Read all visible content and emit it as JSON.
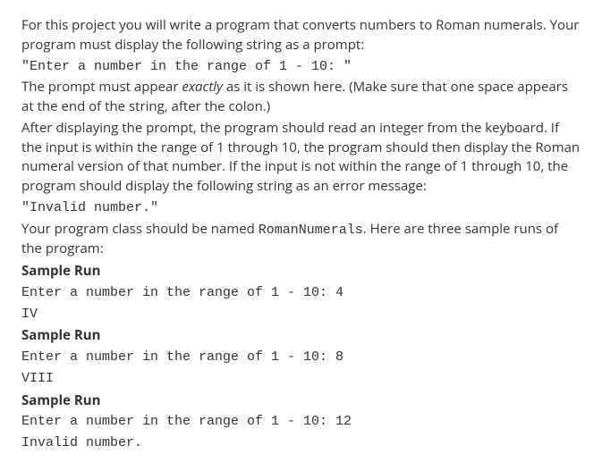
{
  "intro": {
    "p1": "For this project you will write a program that converts numbers to Roman numerals. Your program must display the following string as a prompt:",
    "prompt_code": "\"Enter a number in the range of 1 - 10: \"",
    "p2_a": "The prompt must appear ",
    "p2_exactly": "exactly",
    "p2_b": " as it is shown here. (Make sure that one space appears at the end of the string, after the colon.)",
    "p3": "After displaying the prompt, the program should read an integer from the keyboard. If the input is within the range of 1 through 10, the program should then display the Roman numeral version of that number. If the input is not within the range of 1 through 10, the program should display the following string as an error message:",
    "error_code": "\"Invalid number.\"",
    "p4_a": "Your program class should be named ",
    "p4_classname": "RomanNumerals",
    "p4_b": ". Here are three sample runs of the program:"
  },
  "samples": {
    "heading": "Sample Run",
    "run1": {
      "line1": "Enter a number in the range of 1 - 10: 4",
      "line2": "IV"
    },
    "run2": {
      "line1": "Enter a number in the range of 1 - 10: 8",
      "line2": "VIII"
    },
    "run3": {
      "line1": "Enter a number in the range of 1 - 10: 12",
      "line2": "Invalid number."
    }
  }
}
